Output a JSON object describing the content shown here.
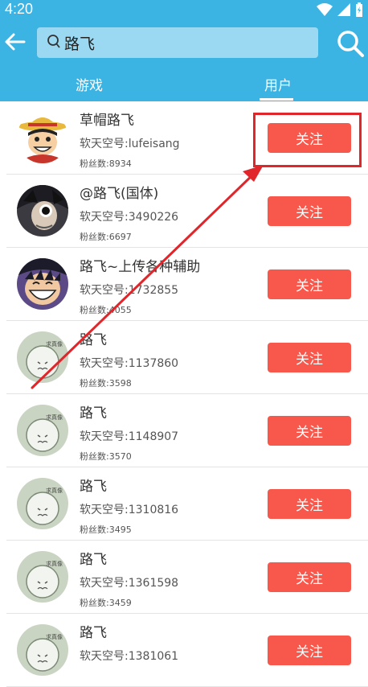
{
  "status": {
    "time": "4:20"
  },
  "header": {
    "search_query": "路飞",
    "tabs": [
      {
        "label": "游戏",
        "active": false
      },
      {
        "label": "用户",
        "active": true
      }
    ]
  },
  "colors": {
    "header": "#3bb3e3",
    "button": "#f8584b",
    "highlight": "#e0262b"
  },
  "users": [
    {
      "name": "草帽路飞",
      "id": "软天空号:lufeisang",
      "fans": "粉丝数:8934",
      "follow": "关注",
      "avatar": "luffy-hat"
    },
    {
      "name": "@路飞(国体)",
      "id": "软天空号:3490226",
      "fans": "粉丝数:6697",
      "follow": "关注",
      "avatar": "anime-dark"
    },
    {
      "name": "路飞~上传各种辅助",
      "id": "软天空号:1732855",
      "fans": "粉丝数:4055",
      "follow": "关注",
      "avatar": "luffy-smile"
    },
    {
      "name": "路飞",
      "id": "软天空号:1137860",
      "fans": "粉丝数:3598",
      "follow": "关注",
      "avatar": "default"
    },
    {
      "name": "路飞",
      "id": "软天空号:1148907",
      "fans": "粉丝数:3570",
      "follow": "关注",
      "avatar": "default"
    },
    {
      "name": "路飞",
      "id": "软天空号:1310816",
      "fans": "粉丝数:3495",
      "follow": "关注",
      "avatar": "default"
    },
    {
      "name": "路飞",
      "id": "软天空号:1361598",
      "fans": "粉丝数:3459",
      "follow": "关注",
      "avatar": "default"
    },
    {
      "name": "路飞",
      "id": "软天空号:1381061",
      "fans": "",
      "follow": "关注",
      "avatar": "default"
    }
  ],
  "default_avatar_text": "求真像"
}
